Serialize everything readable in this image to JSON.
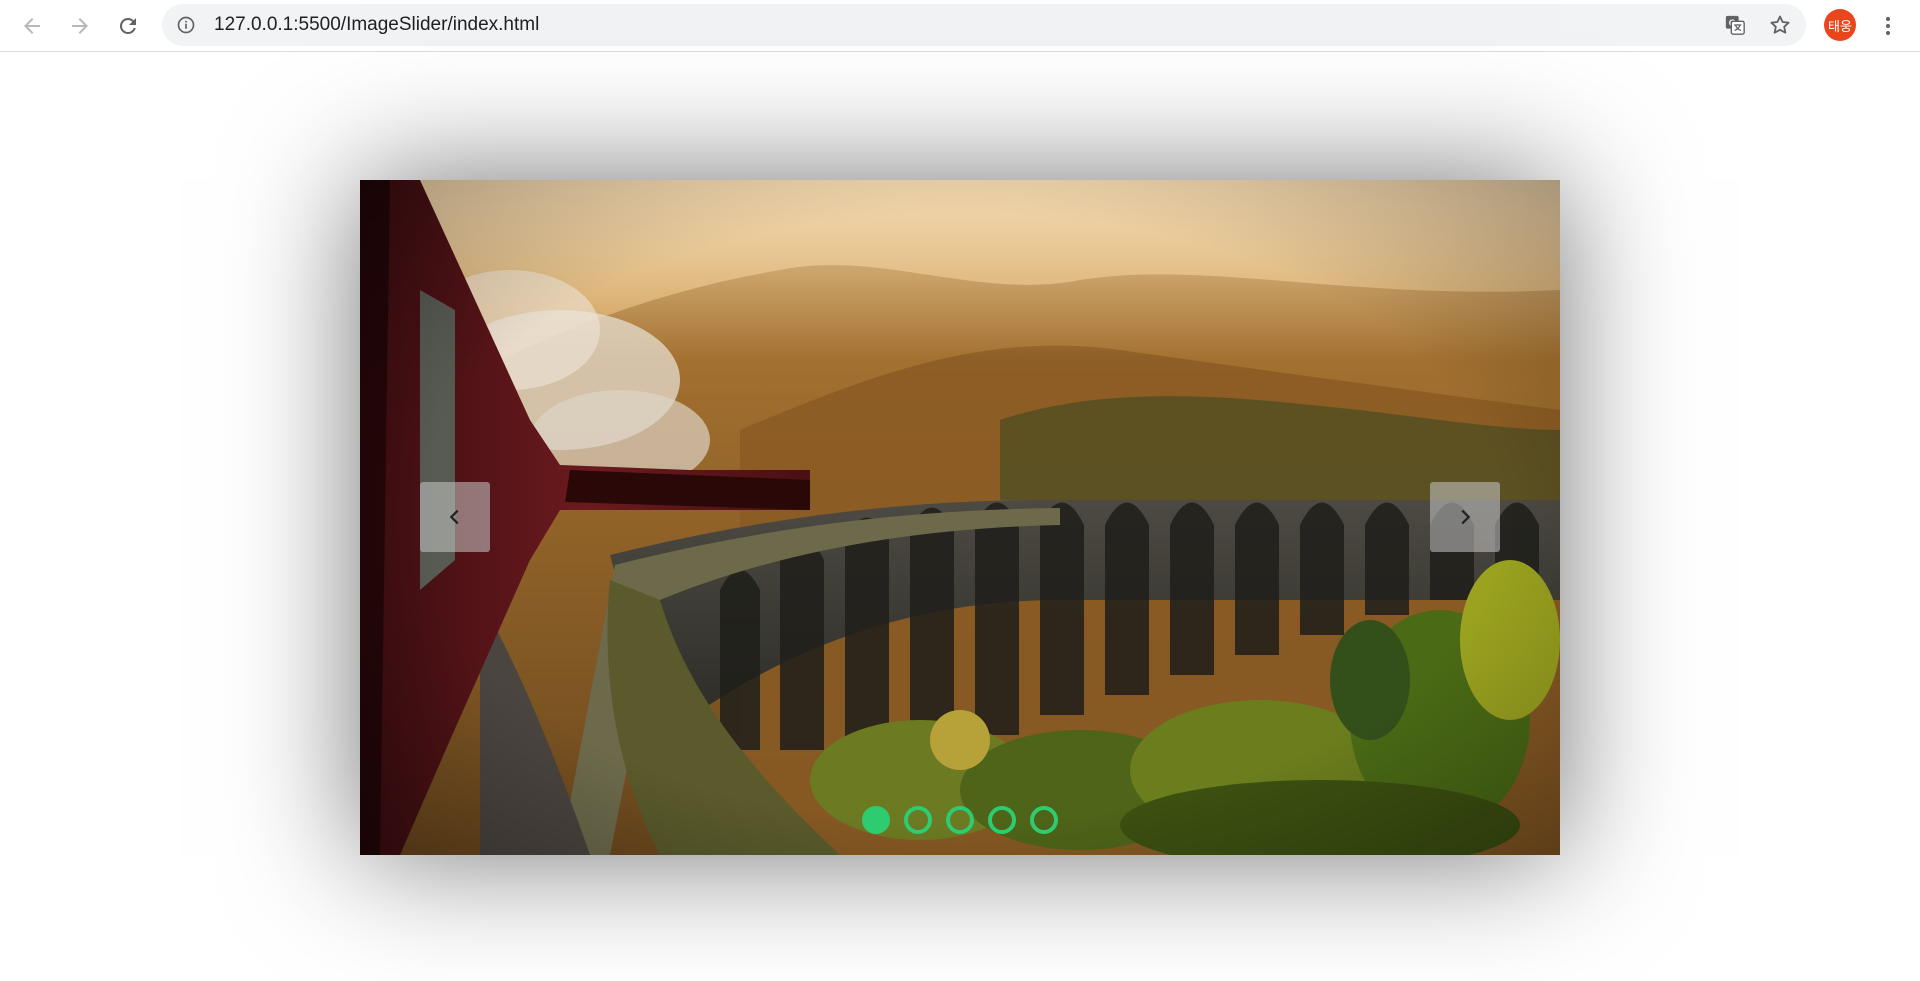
{
  "browser": {
    "url": "127.0.0.1:5500/ImageSlider/index.html",
    "icons": {
      "back": "arrow-left-icon",
      "forward": "arrow-right-icon",
      "reload": "reload-icon",
      "info": "info-icon",
      "translate": "translate-icon",
      "bookmark": "star-icon",
      "menu": "kebab-menu-icon"
    },
    "avatar_text": "태웅",
    "avatar_color": "#e8471e"
  },
  "slider": {
    "current_slide": 1,
    "total_slides": 5,
    "dots": [
      {
        "active": true
      },
      {
        "active": false
      },
      {
        "active": false
      },
      {
        "active": false
      },
      {
        "active": false
      }
    ],
    "accent_color": "#2ecc71",
    "prev_icon": "chevron-left-icon",
    "next_icon": "chevron-right-icon"
  }
}
